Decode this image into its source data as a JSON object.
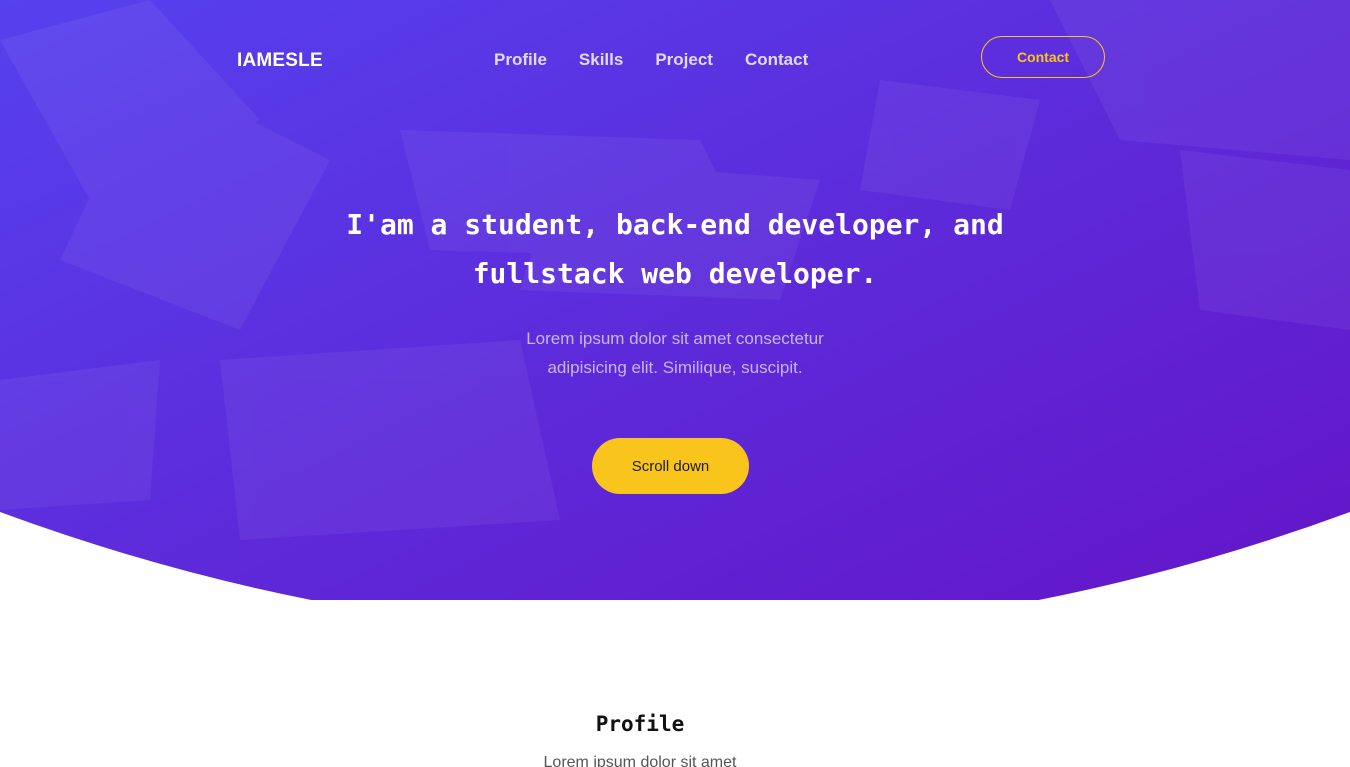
{
  "nav": {
    "logo": "IAMESLE",
    "links": [
      {
        "label": "Profile"
      },
      {
        "label": "Skills"
      },
      {
        "label": "Project"
      },
      {
        "label": "Contact"
      }
    ],
    "contact_button": "Contact"
  },
  "hero": {
    "title": "I'am a student, back-end developer, and fullstack web developer.",
    "subtitle": "Lorem ipsum dolor sit amet consectetur adipisicing elit. Similique, suscipit.",
    "button": "Scroll down"
  },
  "profile": {
    "title": "Profile",
    "text": "Lorem ipsum dolor sit amet"
  },
  "colors": {
    "gradient_start": "#5641ee",
    "gradient_end": "#6414c6",
    "accent": "#f9c51c",
    "background": "#ffffff"
  }
}
